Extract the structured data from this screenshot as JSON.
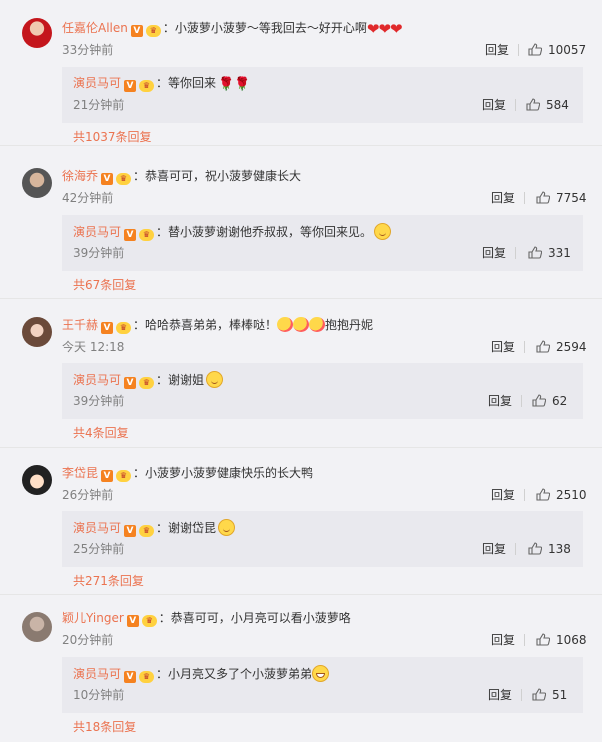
{
  "comments": [
    {
      "user": "任嘉伦Allen",
      "text": "：小菠萝小菠萝～等我回去～好开心啊",
      "emoji": "heart-emoji",
      "time": "33分钟前",
      "reply_label": "回复",
      "likes": "10057",
      "sub": {
        "user": "演员马可",
        "text": "：等你回来",
        "emoji": "rose-emoji",
        "time": "21分钟前",
        "reply_label": "回复",
        "likes": "584"
      },
      "more": "共1037条回复"
    },
    {
      "user": "徐海乔",
      "text": "：恭喜可可，祝小菠萝健康长大",
      "time": "42分钟前",
      "reply_label": "回复",
      "likes": "7754",
      "sub": {
        "user": "演员马可",
        "text": "：替小菠萝谢谢他乔叔叔，等你回来见。",
        "emoji": "smile-emoji",
        "time": "39分钟前",
        "reply_label": "回复",
        "likes": "331"
      },
      "more": "共67条回复"
    },
    {
      "user": "王千赫",
      "text": "：哈哈恭喜弟弟，棒棒哒！",
      "emoji": "hug-emoji",
      "text2": "抱抱丹妮",
      "time": "今天 12:18",
      "reply_label": "回复",
      "likes": "2594",
      "sub": {
        "user": "演员马可",
        "text": "：谢谢姐",
        "emoji": "smile-emoji",
        "time": "39分钟前",
        "reply_label": "回复",
        "likes": "62"
      },
      "more": "共4条回复"
    },
    {
      "user": "李岱昆",
      "text": "：小菠萝小菠萝健康快乐的长大鸭",
      "time": "26分钟前",
      "reply_label": "回复",
      "likes": "2510",
      "sub": {
        "user": "演员马可",
        "text": "：谢谢岱昆",
        "emoji": "smile-emoji",
        "time": "25分钟前",
        "reply_label": "回复",
        "likes": "138"
      },
      "more": "共271条回复"
    },
    {
      "user": "颖儿Yinger",
      "text": "：恭喜可可，小月亮可以看小菠萝咯",
      "time": "20分钟前",
      "reply_label": "回复",
      "likes": "1068",
      "sub": {
        "user": "演员马可",
        "text": "：小月亮又多了个小菠萝弟弟",
        "emoji": "grin-emoji",
        "time": "10分钟前",
        "reply_label": "回复",
        "likes": "51"
      },
      "more": "共18条回复"
    }
  ],
  "badges": {
    "verified": "V",
    "member": "vip"
  },
  "colors": {
    "username": "#eb7350",
    "background": "#f2f2f5",
    "subbox": "#e9e9ee",
    "meta": "#808080"
  }
}
